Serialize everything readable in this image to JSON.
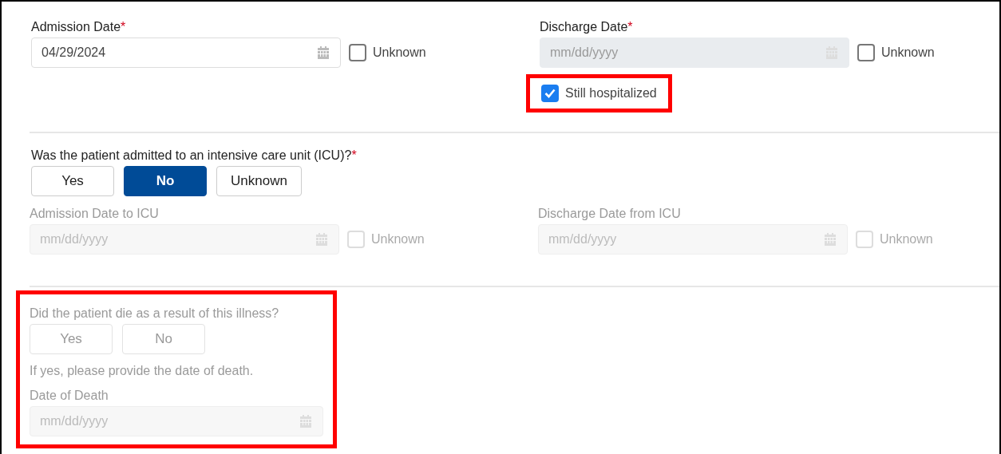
{
  "hospital_dates": {
    "fields": [
      {
        "label": "Admission Date",
        "required_mark": "*",
        "value": "04/29/2024",
        "disabled": false,
        "unknown": {
          "label": "Unknown",
          "checked": false,
          "disabled": false
        }
      },
      {
        "label": "Discharge Date",
        "required_mark": "*",
        "placeholder": "mm/dd/yyyy",
        "disabled": true,
        "unknown": {
          "label": "Unknown",
          "checked": false,
          "disabled": false
        },
        "still_hospitalized": {
          "label": "Still hospitalized",
          "checked": true,
          "highlighted": true
        }
      }
    ]
  },
  "icu": {
    "question": "Was the patient admitted to an intensive care unit (ICU)?",
    "required_mark": "*",
    "disabled": false,
    "options": [
      {
        "label": "Yes",
        "selected": false
      },
      {
        "label": "No",
        "selected": true
      },
      {
        "label": "Unknown",
        "selected": false
      }
    ],
    "fields": [
      {
        "label": "Admission Date to ICU",
        "placeholder": "mm/dd/yyyy",
        "disabled": true,
        "unknown": {
          "label": "Unknown",
          "checked": false,
          "disabled": true
        }
      },
      {
        "label": "Discharge Date from ICU",
        "placeholder": "mm/dd/yyyy",
        "disabled": true,
        "unknown": {
          "label": "Unknown",
          "checked": false,
          "disabled": true
        }
      }
    ]
  },
  "death": {
    "highlighted": true,
    "disabled": true,
    "question": "Did the patient die as a result of this illness?",
    "options": [
      {
        "label": "Yes",
        "selected": false
      },
      {
        "label": "No",
        "selected": false
      }
    ],
    "note": "If yes, please provide the date of death.",
    "field": {
      "label": "Date of Death",
      "placeholder": "mm/dd/yyyy",
      "disabled": true
    }
  }
}
